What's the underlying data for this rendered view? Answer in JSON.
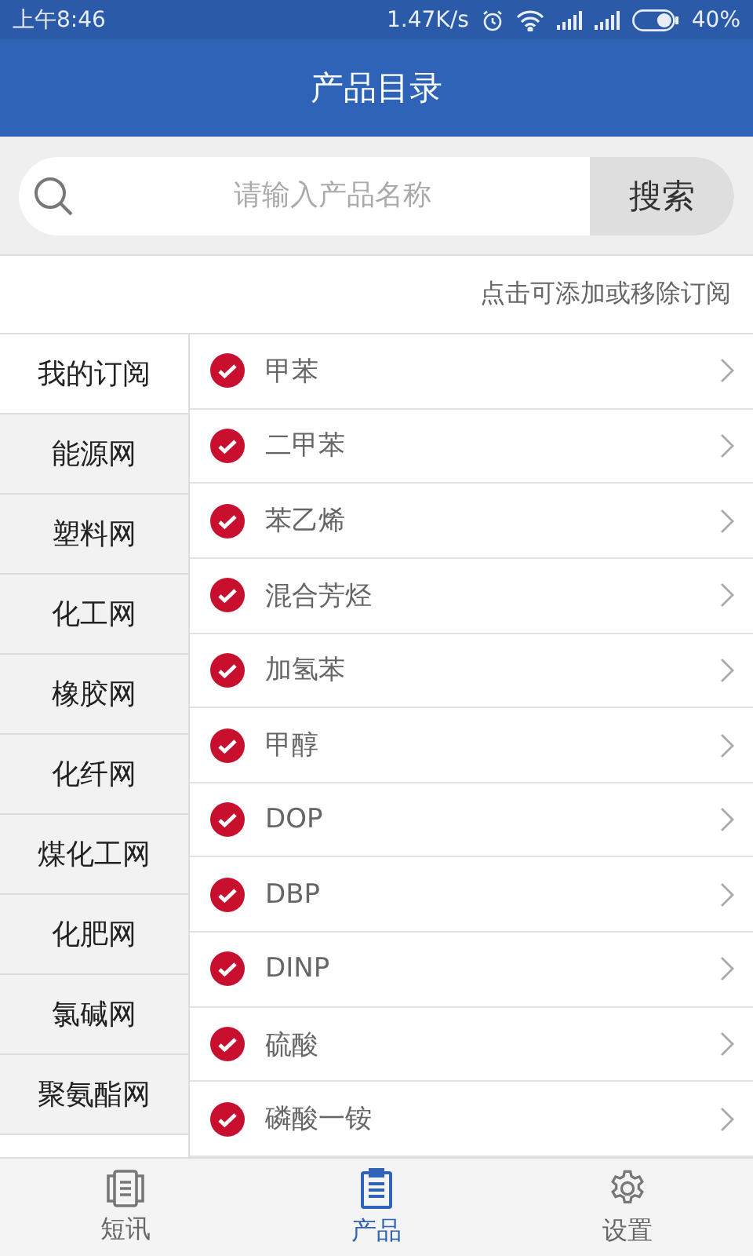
{
  "status_bar": {
    "time": "上午8:46",
    "speed": "1.47K/s",
    "battery": "40%"
  },
  "header": {
    "title": "产品目录"
  },
  "search": {
    "placeholder": "请输入产品名称",
    "button": "搜索"
  },
  "hint": "点击可添加或移除订阅",
  "categories": [
    {
      "label": "我的订阅",
      "selected": true
    },
    {
      "label": "能源网",
      "selected": false
    },
    {
      "label": "塑料网",
      "selected": false
    },
    {
      "label": "化工网",
      "selected": false
    },
    {
      "label": "橡胶网",
      "selected": false
    },
    {
      "label": "化纤网",
      "selected": false
    },
    {
      "label": "煤化工网",
      "selected": false
    },
    {
      "label": "化肥网",
      "selected": false
    },
    {
      "label": "氯碱网",
      "selected": false
    },
    {
      "label": "聚氨酯网",
      "selected": false
    }
  ],
  "products": [
    {
      "name": "甲苯",
      "checked": true
    },
    {
      "name": "二甲苯",
      "checked": true
    },
    {
      "name": "苯乙烯",
      "checked": true
    },
    {
      "name": "混合芳烃",
      "checked": true
    },
    {
      "name": "加氢苯",
      "checked": true
    },
    {
      "name": "甲醇",
      "checked": true
    },
    {
      "name": "DOP",
      "checked": true
    },
    {
      "name": "DBP",
      "checked": true
    },
    {
      "name": "DINP",
      "checked": true
    },
    {
      "name": "硫酸",
      "checked": true
    },
    {
      "name": "磷酸一铵",
      "checked": true
    }
  ],
  "nav": [
    {
      "kind": "news",
      "label": "短讯",
      "selected": false
    },
    {
      "kind": "products",
      "label": "产品",
      "selected": true
    },
    {
      "kind": "settings",
      "label": "设置",
      "selected": false
    }
  ]
}
